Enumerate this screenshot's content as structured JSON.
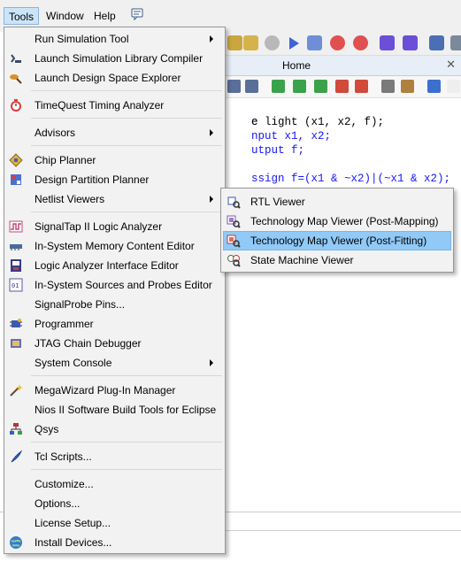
{
  "menubar": {
    "tools": "Tools",
    "window": "Window",
    "help": "Help"
  },
  "document": {
    "tab_title": "Home",
    "close_glyph": "✕"
  },
  "code": {
    "lines": [
      "e light (x1, x2, f);",
      "nput x1, x2;",
      "utput f;",
      "ssign f=(x1 & ~x2)|(~x1 & x2);"
    ]
  },
  "tools_menu": {
    "items": [
      {
        "label": "Run Simulation Tool",
        "icon": "simulation-icon",
        "submenu": true
      },
      {
        "label": "Launch Simulation Library Compiler",
        "icon": "library-compiler-icon"
      },
      {
        "label": "Launch Design Space Explorer",
        "icon": "design-space-explorer-icon"
      },
      {
        "label": "TimeQuest Timing Analyzer",
        "icon": "stopwatch-icon"
      },
      {
        "label": "Advisors",
        "icon": "",
        "submenu": true
      },
      {
        "label": "Chip Planner",
        "icon": "chip-planner-icon"
      },
      {
        "label": "Design Partition Planner",
        "icon": "partition-planner-icon"
      },
      {
        "label": "Netlist Viewers",
        "icon": "",
        "submenu": true
      },
      {
        "label": "SignalTap II Logic Analyzer",
        "icon": "signaltap-icon"
      },
      {
        "label": "In-System Memory Content Editor",
        "icon": "memory-editor-icon"
      },
      {
        "label": "Logic Analyzer Interface Editor",
        "icon": "logic-analyzer-icon"
      },
      {
        "label": "In-System Sources and Probes Editor",
        "icon": "sources-probes-icon"
      },
      {
        "label": "SignalProbe Pins...",
        "icon": ""
      },
      {
        "label": "Programmer",
        "icon": "programmer-icon"
      },
      {
        "label": "JTAG Chain Debugger",
        "icon": "jtag-icon"
      },
      {
        "label": "System Console",
        "icon": "",
        "submenu": true
      },
      {
        "label": "MegaWizard Plug-In Manager",
        "icon": "megawizard-icon"
      },
      {
        "label": "Nios II Software Build Tools for Eclipse",
        "icon": ""
      },
      {
        "label": "Qsys",
        "icon": "qsys-icon"
      },
      {
        "label": "Tcl Scripts...",
        "icon": "tcl-scripts-icon"
      },
      {
        "label": "Customize...",
        "icon": ""
      },
      {
        "label": "Options...",
        "icon": ""
      },
      {
        "label": "License Setup...",
        "icon": ""
      },
      {
        "label": "Install Devices...",
        "icon": "install-devices-icon"
      }
    ]
  },
  "netlist_submenu": {
    "items": [
      {
        "label": "RTL Viewer",
        "icon": "rtl-viewer-icon"
      },
      {
        "label": "Technology Map Viewer (Post-Mapping)",
        "icon": "techmap-post-mapping-icon"
      },
      {
        "label": "Technology Map Viewer (Post-Fitting)",
        "icon": "techmap-post-fitting-icon",
        "highlighted": true
      },
      {
        "label": "State Machine Viewer",
        "icon": "state-machine-viewer-icon"
      }
    ]
  },
  "colors": {
    "menu_bg": "#f2f2f2",
    "highlight": "#91c9f7",
    "keyword": "#1515ff"
  }
}
